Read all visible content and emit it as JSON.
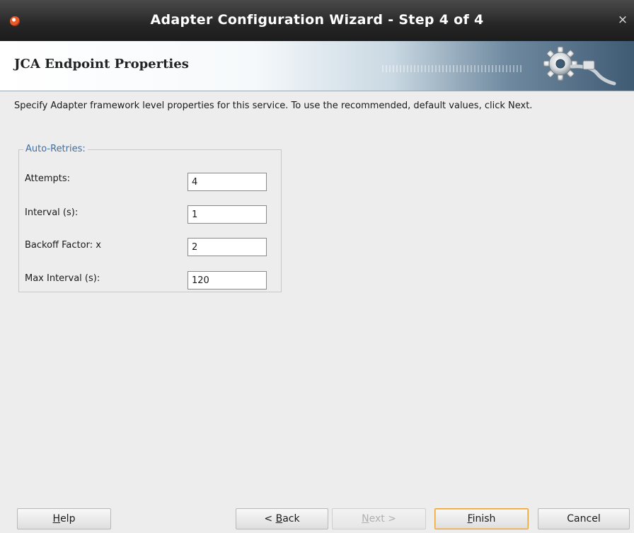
{
  "window": {
    "title": "Adapter Configuration Wizard - Step 4 of 4",
    "close_glyph": "×"
  },
  "header": {
    "title": "JCA Endpoint Properties"
  },
  "description": "Specify Adapter framework level properties for this service.  To use the recommended, default values, click Next.",
  "group": {
    "legend": "Auto-Retries:",
    "fields": [
      {
        "label": "Attempts:",
        "value": "4"
      },
      {
        "label": "Interval (s):",
        "value": "1"
      },
      {
        "label": "Backoff Factor: x",
        "value": "2"
      },
      {
        "label": "Max Interval (s):",
        "value": "120"
      }
    ]
  },
  "buttons": {
    "help": {
      "mnemonic": "H",
      "rest": "elp"
    },
    "back": {
      "prefix": "< ",
      "mnemonic": "B",
      "rest": "ack"
    },
    "next": {
      "mnemonic": "N",
      "rest": "ext >"
    },
    "finish": {
      "mnemonic": "F",
      "rest": "inish"
    },
    "cancel": {
      "label": "Cancel"
    }
  },
  "colors": {
    "titlebar": "#262626",
    "legend_text": "#3f6ea3",
    "default_button_border": "#e7a33b"
  },
  "icons": {
    "app": "oracle-jdeveloper-app-icon",
    "close": "close-icon",
    "banner": "gear-plug-icon"
  }
}
